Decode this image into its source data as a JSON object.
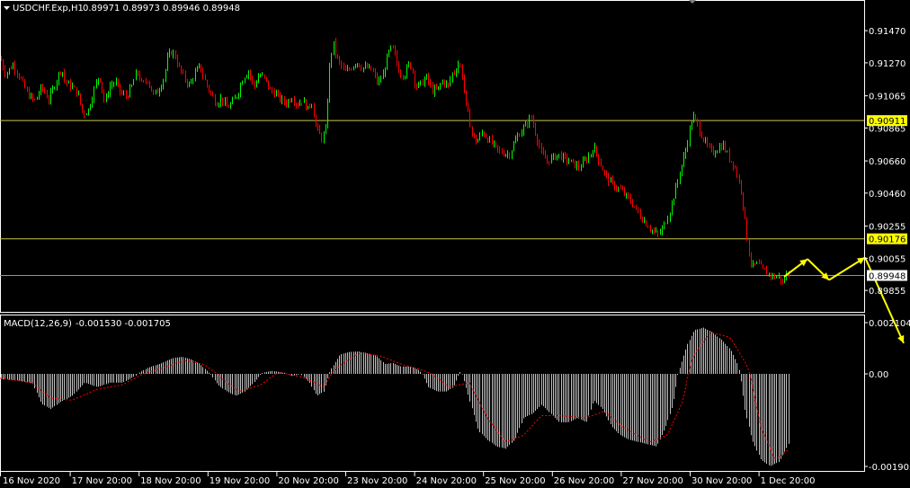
{
  "colors": {
    "background": "#000000",
    "panel_border": "#ffffff",
    "bull": "#00ff00",
    "bear": "#ff0000",
    "level": "#c8c84b",
    "level_label_bg": "#ffff00",
    "current_price_line": "#8c96a0",
    "current_label_bg": "#ffffff",
    "histogram": "#c0c0c0",
    "signal": "#ff0000",
    "projection": "#ffff00",
    "text": "#ffffff"
  },
  "header": {
    "symbol": "USDCHF.Exp,H1",
    "ohlc": "0.89971 0.89973 0.89946 0.89948"
  },
  "macd_header": {
    "name": "MACD(12,26,9)",
    "values": "-0.001530 -0.001705"
  },
  "price_axis": {
    "ticks": [
      "0.91470",
      "0.91270",
      "0.91065",
      "0.90865",
      "0.90660",
      "0.90460",
      "0.90255",
      "0.90055",
      "0.89855"
    ],
    "level_labels": [
      "0.90911",
      "0.90176"
    ],
    "current_label": "0.89948"
  },
  "macd_axis": {
    "ticks": [
      "0.002104",
      "0.00",
      "-0.001903"
    ]
  },
  "time_axis": {
    "labels": [
      "16 Nov 2020",
      "17 Nov 20:00",
      "18 Nov 20:00",
      "19 Nov 20:00",
      "20 Nov 20:00",
      "23 Nov 20:00",
      "24 Nov 20:00",
      "25 Nov 20:00",
      "26 Nov 20:00",
      "27 Nov 20:00",
      "30 Nov 20:00",
      "1 Dec 20:00"
    ]
  },
  "chart_data": [
    {
      "type": "candlestick",
      "title": "USDCHF.Exp,H1",
      "timeframe": "H1",
      "x_labels": [
        "16 Nov 2020",
        "17 Nov 20:00",
        "18 Nov 20:00",
        "19 Nov 20:00",
        "20 Nov 20:00",
        "23 Nov 20:00",
        "24 Nov 20:00",
        "25 Nov 20:00",
        "26 Nov 20:00",
        "27 Nov 20:00",
        "30 Nov 20:00",
        "1 Dec 20:00"
      ],
      "ylim": [
        0.898,
        0.9156
      ],
      "last_bar": {
        "open": 0.89971,
        "high": 0.89973,
        "low": 0.89946,
        "close": 0.89948
      },
      "horizontal_levels": [
        0.90911,
        0.90176
      ],
      "current_price": 0.89948,
      "close_path": [
        [
          0,
          0.913
        ],
        [
          6,
          0.912
        ],
        [
          14,
          0.9126
        ],
        [
          22,
          0.9118
        ],
        [
          30,
          0.9108
        ],
        [
          38,
          0.9103
        ],
        [
          46,
          0.9112
        ],
        [
          54,
          0.9104
        ],
        [
          62,
          0.9116
        ],
        [
          68,
          0.9124
        ],
        [
          72,
          0.9115
        ],
        [
          80,
          0.9112
        ],
        [
          86,
          0.9108
        ],
        [
          92,
          0.9095
        ],
        [
          98,
          0.9098
        ],
        [
          104,
          0.911
        ],
        [
          110,
          0.912
        ],
        [
          116,
          0.9102
        ],
        [
          122,
          0.9113
        ],
        [
          128,
          0.9115
        ],
        [
          134,
          0.9108
        ],
        [
          140,
          0.9106
        ],
        [
          146,
          0.9112
        ],
        [
          152,
          0.9122
        ],
        [
          158,
          0.9113
        ],
        [
          164,
          0.9117
        ],
        [
          170,
          0.9107
        ],
        [
          176,
          0.911
        ],
        [
          182,
          0.9118
        ],
        [
          186,
          0.913
        ],
        [
          190,
          0.9134
        ],
        [
          194,
          0.9132
        ],
        [
          198,
          0.9125
        ],
        [
          204,
          0.9118
        ],
        [
          210,
          0.9113
        ],
        [
          216,
          0.912
        ],
        [
          222,
          0.9125
        ],
        [
          228,
          0.9115
        ],
        [
          234,
          0.9108
        ],
        [
          240,
          0.9102
        ],
        [
          246,
          0.9105
        ],
        [
          252,
          0.9099
        ],
        [
          258,
          0.9102
        ],
        [
          264,
          0.9108
        ],
        [
          270,
          0.9118
        ],
        [
          276,
          0.9122
        ],
        [
          282,
          0.9112
        ],
        [
          288,
          0.912
        ],
        [
          294,
          0.9117
        ],
        [
          300,
          0.911
        ],
        [
          306,
          0.9108
        ],
        [
          312,
          0.9104
        ],
        [
          318,
          0.9102
        ],
        [
          324,
          0.9106
        ],
        [
          330,
          0.9101
        ],
        [
          336,
          0.9104
        ],
        [
          342,
          0.9098
        ],
        [
          346,
          0.9104
        ],
        [
          350,
          0.909
        ],
        [
          354,
          0.9083
        ],
        [
          358,
          0.908
        ],
        [
          362,
          0.9085
        ],
        [
          366,
          0.9124
        ],
        [
          370,
          0.914
        ],
        [
          374,
          0.913
        ],
        [
          378,
          0.9126
        ],
        [
          384,
          0.9121
        ],
        [
          390,
          0.9124
        ],
        [
          396,
          0.9128
        ],
        [
          402,
          0.9124
        ],
        [
          408,
          0.9124
        ],
        [
          414,
          0.9122
        ],
        [
          420,
          0.9114
        ],
        [
          426,
          0.912
        ],
        [
          430,
          0.913
        ],
        [
          434,
          0.9136
        ],
        [
          438,
          0.9134
        ],
        [
          442,
          0.9124
        ],
        [
          446,
          0.912
        ],
        [
          450,
          0.912
        ],
        [
          454,
          0.9126
        ],
        [
          458,
          0.9124
        ],
        [
          462,
          0.9112
        ],
        [
          468,
          0.9114
        ],
        [
          474,
          0.9118
        ],
        [
          480,
          0.911
        ],
        [
          486,
          0.911
        ],
        [
          492,
          0.9116
        ],
        [
          498,
          0.9112
        ],
        [
          502,
          0.912
        ],
        [
          506,
          0.9122
        ],
        [
          510,
          0.9128
        ],
        [
          514,
          0.9118
        ],
        [
          518,
          0.91
        ],
        [
          522,
          0.909
        ],
        [
          526,
          0.908
        ],
        [
          530,
          0.9078
        ],
        [
          536,
          0.9084
        ],
        [
          542,
          0.908
        ],
        [
          548,
          0.9076
        ],
        [
          554,
          0.9072
        ],
        [
          560,
          0.9071
        ],
        [
          566,
          0.907
        ],
        [
          572,
          0.9078
        ],
        [
          578,
          0.9084
        ],
        [
          584,
          0.9088
        ],
        [
          590,
          0.9094
        ],
        [
          596,
          0.9082
        ],
        [
          602,
          0.907
        ],
        [
          608,
          0.9066
        ],
        [
          614,
          0.9068
        ],
        [
          620,
          0.907
        ],
        [
          626,
          0.9068
        ],
        [
          632,
          0.9066
        ],
        [
          638,
          0.9064
        ],
        [
          644,
          0.9062
        ],
        [
          650,
          0.9066
        ],
        [
          656,
          0.907
        ],
        [
          660,
          0.9075
        ],
        [
          666,
          0.9066
        ],
        [
          672,
          0.9058
        ],
        [
          678,
          0.9053
        ],
        [
          684,
          0.905
        ],
        [
          690,
          0.9048
        ],
        [
          696,
          0.9044
        ],
        [
          702,
          0.904
        ],
        [
          708,
          0.9035
        ],
        [
          714,
          0.903
        ],
        [
          720,
          0.9026
        ],
        [
          726,
          0.9022
        ],
        [
          732,
          0.902
        ],
        [
          738,
          0.9026
        ],
        [
          744,
          0.9034
        ],
        [
          750,
          0.9046
        ],
        [
          756,
          0.906
        ],
        [
          762,
          0.9072
        ],
        [
          766,
          0.9084
        ],
        [
          770,
          0.9094
        ],
        [
          774,
          0.909
        ],
        [
          780,
          0.9082
        ],
        [
          786,
          0.9075
        ],
        [
          792,
          0.9071
        ],
        [
          798,
          0.9074
        ],
        [
          804,
          0.9076
        ],
        [
          810,
          0.9068
        ],
        [
          816,
          0.9064
        ],
        [
          820,
          0.9056
        ],
        [
          824,
          0.9048
        ],
        [
          828,
          0.903
        ],
        [
          832,
          0.901
        ],
        [
          836,
          0.9
        ],
        [
          842,
          0.9002
        ],
        [
          848,
          0.8998
        ],
        [
          854,
          0.8996
        ],
        [
          860,
          0.8994
        ],
        [
          866,
          0.8994
        ],
        [
          870,
          0.899
        ],
        [
          874,
          0.8996
        ],
        [
          877,
          0.89948
        ]
      ]
    },
    {
      "type": "histogram",
      "title": "MACD(12,26,9)",
      "main_value": -0.00153,
      "signal_value": -0.001705,
      "ylim": [
        -0.002104,
        0.002104
      ],
      "histogram_path": [
        [
          0,
          -0.00012
        ],
        [
          20,
          -0.00015
        ],
        [
          36,
          -0.00022
        ],
        [
          46,
          -0.00068
        ],
        [
          56,
          -0.0008
        ],
        [
          66,
          -0.00065
        ],
        [
          80,
          -0.0005
        ],
        [
          94,
          -0.0002
        ],
        [
          108,
          -0.0003
        ],
        [
          122,
          -0.0002
        ],
        [
          136,
          -0.0002
        ],
        [
          150,
          -5e-05
        ],
        [
          164,
          0.00025
        ],
        [
          178,
          0.00042
        ],
        [
          192,
          0.00065
        ],
        [
          202,
          0.0007
        ],
        [
          212,
          0.0006
        ],
        [
          222,
          0.0004
        ],
        [
          232,
          5e-05
        ],
        [
          242,
          -0.00025
        ],
        [
          252,
          -0.0004
        ],
        [
          262,
          -0.0005
        ],
        [
          272,
          -0.0004
        ],
        [
          282,
          -0.0002
        ],
        [
          292,
          5e-05
        ],
        [
          302,
          0.00012
        ],
        [
          314,
          6e-05
        ],
        [
          324,
          -5e-05
        ],
        [
          334,
          0.0
        ],
        [
          344,
          -0.0002
        ],
        [
          352,
          -0.0005
        ],
        [
          360,
          -0.0004
        ],
        [
          368,
          0.0002
        ],
        [
          378,
          0.0008
        ],
        [
          388,
          0.0009
        ],
        [
          398,
          0.00092
        ],
        [
          408,
          0.00085
        ],
        [
          418,
          0.00075
        ],
        [
          428,
          0.0004
        ],
        [
          436,
          0.00045
        ],
        [
          446,
          0.0003
        ],
        [
          456,
          0.0003
        ],
        [
          466,
          0.00015
        ],
        [
          476,
          -0.0003
        ],
        [
          486,
          -0.0004
        ],
        [
          496,
          -0.0004
        ],
        [
          504,
          -0.0003
        ],
        [
          512,
          0.0001
        ],
        [
          522,
          -0.0006
        ],
        [
          532,
          -0.0013
        ],
        [
          542,
          -0.0015
        ],
        [
          552,
          -0.00165
        ],
        [
          562,
          -0.0017
        ],
        [
          572,
          -0.0015
        ],
        [
          582,
          -0.001
        ],
        [
          592,
          -0.0009
        ],
        [
          602,
          -0.0007
        ],
        [
          612,
          -0.0009
        ],
        [
          622,
          -0.0011
        ],
        [
          632,
          -0.0011
        ],
        [
          642,
          -0.001
        ],
        [
          652,
          -0.0011
        ],
        [
          660,
          -0.0006
        ],
        [
          670,
          -0.0008
        ],
        [
          680,
          -0.0012
        ],
        [
          690,
          -0.0014
        ],
        [
          700,
          -0.0015
        ],
        [
          710,
          -0.00155
        ],
        [
          720,
          -0.0016
        ],
        [
          730,
          -0.00165
        ],
        [
          740,
          -0.0012
        ],
        [
          748,
          -0.0007
        ],
        [
          756,
          0.0003
        ],
        [
          764,
          0.0012
        ],
        [
          772,
          0.0018
        ],
        [
          782,
          0.0019
        ],
        [
          792,
          0.0017
        ],
        [
          802,
          0.0014
        ],
        [
          812,
          0.001
        ],
        [
          820,
          0.0004
        ],
        [
          828,
          -0.0008
        ],
        [
          836,
          -0.0015
        ],
        [
          846,
          -0.00195
        ],
        [
          856,
          -0.0021
        ],
        [
          866,
          -0.002
        ],
        [
          874,
          -0.0017
        ],
        [
          878,
          -0.00153
        ]
      ],
      "signal_path": [
        [
          0,
          -0.0001
        ],
        [
          36,
          -0.0002
        ],
        [
          56,
          -0.00055
        ],
        [
          80,
          -0.0006
        ],
        [
          108,
          -0.00035
        ],
        [
          136,
          -0.00025
        ],
        [
          164,
          5e-05
        ],
        [
          186,
          0.0003
        ],
        [
          206,
          0.00055
        ],
        [
          226,
          0.0004
        ],
        [
          246,
          -0.0001
        ],
        [
          266,
          -0.0004
        ],
        [
          290,
          -0.00025
        ],
        [
          310,
          5e-05
        ],
        [
          340,
          -0.0001
        ],
        [
          360,
          -0.0003
        ],
        [
          380,
          0.0004
        ],
        [
          400,
          0.00085
        ],
        [
          422,
          0.00075
        ],
        [
          446,
          0.0004
        ],
        [
          470,
          0.00015
        ],
        [
          500,
          -0.0003
        ],
        [
          522,
          -0.0002
        ],
        [
          542,
          -0.001
        ],
        [
          562,
          -0.00155
        ],
        [
          582,
          -0.0014
        ],
        [
          602,
          -0.00095
        ],
        [
          622,
          -0.00095
        ],
        [
          652,
          -0.001
        ],
        [
          672,
          -0.00085
        ],
        [
          692,
          -0.0012
        ],
        [
          722,
          -0.00155
        ],
        [
          742,
          -0.0014
        ],
        [
          760,
          -0.0006
        ],
        [
          772,
          0.0008
        ],
        [
          790,
          0.0017
        ],
        [
          812,
          0.0015
        ],
        [
          830,
          0.0004
        ],
        [
          846,
          -0.0012
        ],
        [
          862,
          -0.00195
        ],
        [
          878,
          -0.001705
        ]
      ]
    }
  ],
  "projection": {
    "points": [
      [
        872,
        0.8994
      ],
      [
        898,
        0.9005
      ],
      [
        922,
        0.8992
      ],
      [
        962,
        0.9006
      ],
      [
        1005,
        0.8962
      ]
    ],
    "end_arrow_tail": [
      1005,
      0.8962
    ],
    "end_arrow_head_macd": 0.0003
  }
}
